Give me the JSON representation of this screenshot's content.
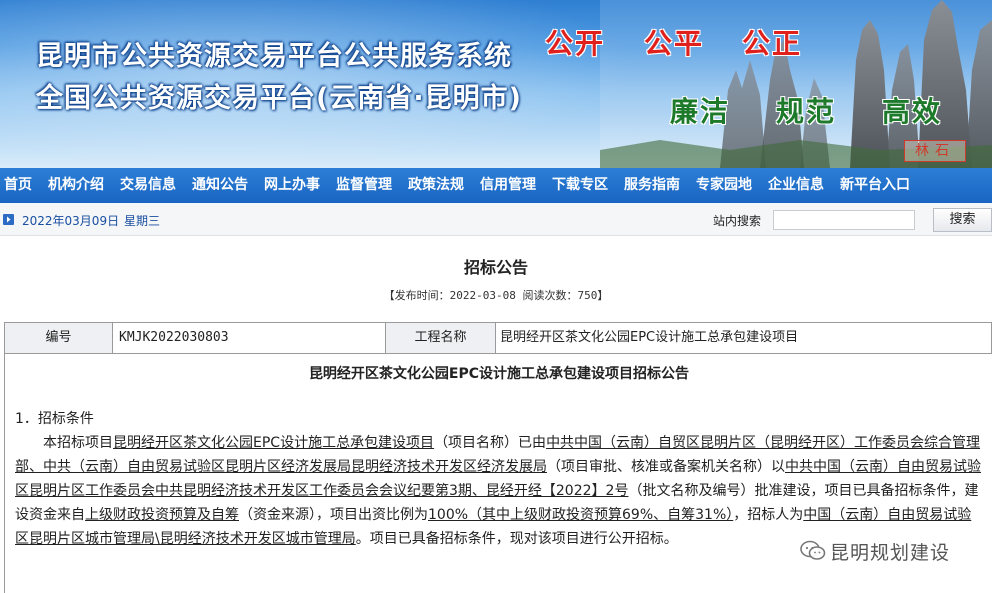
{
  "banner": {
    "title_line1": "昆明市公共资源交易平台公共服务系统",
    "title_line2": "全国公共资源交易平台(云南省·昆明市)",
    "slogans_red": [
      "公开",
      "公平",
      "公正"
    ],
    "slogans_green": [
      "廉洁",
      "规范",
      "高效"
    ],
    "stone_mark": "林石"
  },
  "nav": {
    "items": [
      "首页",
      "机构介绍",
      "交易信息",
      "通知公告",
      "网上办事",
      "监督管理",
      "政策法规",
      "信用管理",
      "下载专区",
      "服务指南",
      "专家园地",
      "企业信息",
      "新平台入口"
    ]
  },
  "datebar": {
    "date": "2022年03月09日",
    "weekday": "星期三",
    "search_label": "站内搜索",
    "search_value": "",
    "search_button": "搜索"
  },
  "article": {
    "title": "招标公告",
    "meta": "【发布时间：2022-03-08 阅读次数：750】"
  },
  "table": {
    "label_number": "编号",
    "value_number": "KMJK2022030803",
    "label_project": "工程名称",
    "value_project": "昆明经开区茶文化公园EPC设计施工总承包建设项目"
  },
  "content": {
    "title": "昆明经开区茶文化公园EPC设计施工总承包建设项目招标公告",
    "section1": "1．招标条件",
    "p_prefix": "本招标项目",
    "p_project": "昆明经开区茶文化公园EPC设计施工总承包建设项目",
    "p_mid1": "（项目名称）已由",
    "p_approver": "中共中国（云南）自贸区昆明片区（昆明经开区）工作委员会综合管理部、中共（云南）自由贸易试验区昆明片区经济发展局昆明经济技术开发区经济发展局",
    "p_mid2": "（项目审批、核准或备案机关名称）以",
    "p_doc": "中共中国（云南）自由贸易试验区昆明片区工作委员会中共昆明经济技术开发区工作委员会会议纪要第3期、昆经开经【2022】2号",
    "p_mid3": "（批文名称及编号）批准建设，项目已具备招标条件，建设资金来自",
    "p_fund": "上级财政投资预算及自筹",
    "p_mid4": "（资金来源），项目出资比例为",
    "p_ratio": "100%（其中上级财政投资预算69%、自筹31%）",
    "p_mid5": "，招标人为",
    "p_owner": "中国（云南）自由贸易试验区昆明片区城市管理局\\昆明经济技术开发区城市管理局",
    "p_end": "。项目已具备招标条件，现对该项目进行公开招标。"
  },
  "watermark": {
    "text": "昆明规划建设"
  }
}
